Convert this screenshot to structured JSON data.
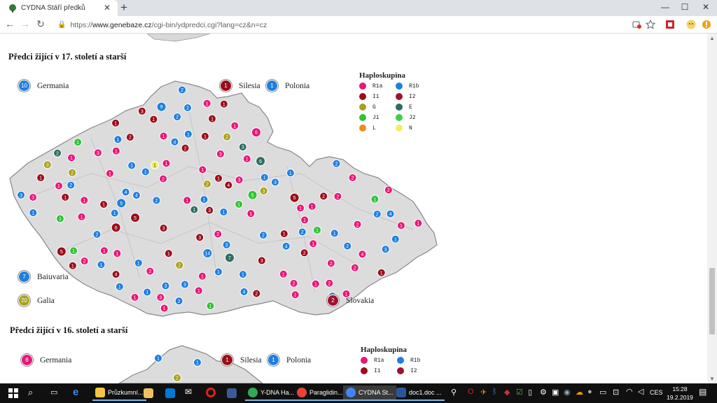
{
  "browser": {
    "tab_title": "CYDNA Stáří předků",
    "url_scheme": "https://",
    "url_host": "www.genebaze.cz",
    "url_path": "/cgi-bin/ydpredci.cgi?lang=cz&n=cz"
  },
  "section1": {
    "heading": "Předci žijící v 17. století a starší",
    "regions": [
      {
        "name": "Germania",
        "count": "10"
      },
      {
        "name": "Silesia",
        "count": "1"
      },
      {
        "name": "Polonia",
        "count": "1"
      },
      {
        "name": "Baiuvaria",
        "count": "7"
      },
      {
        "name": "Galia",
        "count": "20"
      },
      {
        "name": "Slovakia",
        "count": "2"
      }
    ],
    "legend_title": "Haploskupina",
    "legend": [
      {
        "label": "R1a",
        "color": "#e8177a"
      },
      {
        "label": "R1b",
        "color": "#1e7fe0"
      },
      {
        "label": "I1",
        "color": "#9b0d1a"
      },
      {
        "label": "I2",
        "color": "#a01030"
      },
      {
        "label": "G",
        "color": "#a8a21a"
      },
      {
        "label": "E",
        "color": "#2e6e62"
      },
      {
        "label": "J1",
        "color": "#2ec436"
      },
      {
        "label": "J2",
        "color": "#3cd048"
      },
      {
        "label": "L",
        "color": "#f08a20"
      },
      {
        "label": "N",
        "color": "#f2ee60"
      }
    ]
  },
  "section2": {
    "heading": "Předci žijící v 16. století a starší",
    "regions": [
      {
        "name": "Germania",
        "count": "8"
      },
      {
        "name": "Silesia",
        "count": "1"
      },
      {
        "name": "Polonia",
        "count": "1"
      }
    ],
    "legend_title": "Haploskupina",
    "legend": [
      {
        "label": "R1a",
        "color": "#e8177a"
      },
      {
        "label": "R1b",
        "color": "#1e7fe0"
      },
      {
        "label": "I1",
        "color": "#9b0d1a"
      },
      {
        "label": "I2",
        "color": "#a01030"
      }
    ]
  },
  "map_markers": [
    [
      "1",
      "#1e7fe0"
    ],
    [
      "1",
      "#1e7fe0"
    ],
    [
      "1",
      "#1e7fe0"
    ],
    [
      "1",
      "#1e7fe0"
    ],
    [
      "2",
      "#a8a21a"
    ],
    [
      "5",
      "#2ec436"
    ],
    [
      "2",
      "#1e7fe0"
    ],
    [
      "1",
      "#2e6e62"
    ],
    [
      "1",
      "#9b0d1a"
    ],
    [
      "1",
      "#e8177a"
    ],
    [
      "2",
      "#e8177a"
    ],
    [
      "1",
      "#e8177a"
    ],
    [
      "1",
      "#1e7fe0"
    ],
    [
      "1",
      "#1e7fe0"
    ],
    [
      "1",
      "#e8177a"
    ],
    [
      "1",
      "#9b0d1a"
    ],
    [
      "2",
      "#1e7fe0"
    ],
    [
      "1",
      "#e8177a"
    ],
    [
      "2",
      "#a8a21a"
    ],
    [
      "2",
      "#9b0d1a"
    ],
    [
      "1",
      "#f2ee60"
    ],
    [
      "1",
      "#e8177a"
    ],
    [
      "2",
      "#9b0d1a"
    ],
    [
      "3",
      "#a8a21a"
    ],
    [
      "1",
      "#9b0d1a"
    ],
    [
      "1",
      "#e8177a"
    ],
    [
      "2",
      "#e8177a"
    ],
    [
      "4",
      "#9b0d1a"
    ],
    [
      "1",
      "#1e7fe0"
    ],
    [
      "4",
      "#1e7fe0"
    ],
    [
      "3",
      "#a8a21a"
    ],
    [
      "1",
      "#e8177a"
    ],
    [
      "2",
      "#1e7fe0"
    ],
    [
      "1",
      "#9b0d1a"
    ],
    [
      "14",
      "#1e7fe0"
    ],
    [
      "3",
      "#e8177a"
    ],
    [
      "1",
      "#2ec436"
    ],
    [
      "1",
      "#1e7fe0"
    ],
    [
      "3",
      "#e8177a"
    ],
    [
      "1",
      "#e8177a"
    ],
    [
      "4",
      "#1e7fe0"
    ],
    [
      "3",
      "#e8177a"
    ],
    [
      "5",
      "#9b0d1a"
    ],
    [
      "1",
      "#1e7fe0"
    ],
    [
      "1",
      "#2ec436"
    ],
    [
      "3",
      "#1e7fe0"
    ],
    [
      "1",
      "#e8177a"
    ],
    [
      "1",
      "#e8177a"
    ],
    [
      "1",
      "#1e7fe0"
    ],
    [
      "2",
      "#e8177a"
    ],
    [
      "4",
      "#9b0d1a"
    ],
    [
      "3",
      "#1e7fe0"
    ],
    [
      "1",
      "#9b0d1a"
    ],
    [
      "2",
      "#1e7fe0"
    ],
    [
      "1",
      "#e8177a"
    ],
    [
      "1",
      "#1e7fe0"
    ],
    [
      "2",
      "#e8177a"
    ],
    [
      "4",
      "#1e7fe0"
    ],
    [
      "1",
      "#e8177a"
    ],
    [
      "3",
      "#9b0d1a"
    ],
    [
      "1",
      "#1e7fe0"
    ],
    [
      "2",
      "#1e7fe0"
    ],
    [
      "1",
      "#2ec436"
    ],
    [
      "3",
      "#2e6e62"
    ],
    [
      "1",
      "#e8177a"
    ],
    [
      "2",
      "#9b0d1a"
    ],
    [
      "6",
      "#9b0d1a"
    ],
    [
      "2",
      "#1e7fe0"
    ],
    [
      "2",
      "#e8177a"
    ],
    [
      "1",
      "#9b0d1a"
    ],
    [
      "1",
      "#e8177a"
    ],
    [
      "2",
      "#1e7fe0"
    ],
    [
      "5",
      "#9b0d1a"
    ],
    [
      "1",
      "#e8177a"
    ],
    [
      "1",
      "#e8177a"
    ],
    [
      "2",
      "#a8a21a"
    ],
    [
      "4",
      "#e8177a"
    ],
    [
      "1",
      "#2ec436"
    ],
    [
      "3",
      "#1e7fe0"
    ],
    [
      "1",
      "#e8177a"
    ],
    [
      "2",
      "#e8177a"
    ],
    [
      "1",
      "#9b0d1a"
    ],
    [
      "3",
      "#e8177a"
    ],
    [
      "5",
      "#1e7fe0"
    ],
    [
      "6",
      "#e8177a"
    ],
    [
      "2",
      "#1e7fe0"
    ],
    [
      "1",
      "#9b0d1a"
    ],
    [
      "3",
      "#1e7fe0"
    ],
    [
      "2",
      "#2e6e62"
    ],
    [
      "3",
      "#9b0d1a"
    ],
    [
      "2",
      "#9b0d1a"
    ],
    [
      "1",
      "#e8177a"
    ],
    [
      "2",
      "#e8177a"
    ],
    [
      "1",
      "#9b0d1a"
    ],
    [
      "3",
      "#1e7fe0"
    ],
    [
      "1",
      "#9b0d1a"
    ],
    [
      "1",
      "#e8177a"
    ],
    [
      "2",
      "#9b0d1a"
    ],
    [
      "3",
      "#e8177a"
    ],
    [
      "1",
      "#1e7fe0"
    ],
    [
      "2",
      "#a8a21a"
    ],
    [
      "3",
      "#9b0d1a"
    ],
    [
      "1",
      "#e8177a"
    ],
    [
      "2",
      "#e8177a"
    ],
    [
      "1",
      "#1e7fe0"
    ],
    [
      "4",
      "#1e7fe0"
    ],
    [
      "1",
      "#1e7fe0"
    ],
    [
      "7",
      "#2e6e62"
    ],
    [
      "3",
      "#9b0d1a"
    ],
    [
      "1",
      "#9b0d1a"
    ],
    [
      "1",
      "#e8177a"
    ],
    [
      "2",
      "#1e7fe0"
    ],
    [
      "9",
      "#1e7fe0"
    ],
    [
      "1",
      "#2ec436"
    ],
    [
      "2",
      "#1e7fe0"
    ],
    [
      "1",
      "#9b0d1a"
    ],
    [
      "1",
      "#1e7fe0"
    ],
    [
      "1",
      "#e8177a"
    ],
    [
      "3",
      "#1e7fe0"
    ],
    [
      "1",
      "#e8177a"
    ],
    [
      "2",
      "#e8177a"
    ],
    [
      "1",
      "#e8177a"
    ],
    [
      "2",
      "#1e7fe0"
    ],
    [
      "3",
      "#9b0d1a"
    ],
    [
      "5",
      "#9b0d1a"
    ],
    [
      "1",
      "#e8177a"
    ],
    [
      "6",
      "#2e6e62"
    ],
    [
      "2",
      "#1e7fe0"
    ],
    [
      "4",
      "#1e7fe0"
    ],
    [
      "1",
      "#2ec436"
    ],
    [
      "1",
      "#e8177a"
    ],
    [
      "2",
      "#e8177a"
    ],
    [
      "1",
      "#e8177a"
    ],
    [
      "1",
      "#1e7fe0"
    ],
    [
      "4",
      "#1e7fe0"
    ],
    [
      "2",
      "#e8177a"
    ],
    [
      "1",
      "#e8177a"
    ],
    [
      "1",
      "#2ec436"
    ],
    [
      "1",
      "#9b0d1a"
    ],
    [
      "1",
      "#1e7fe0"
    ],
    [
      "1",
      "#e8177a"
    ],
    [
      "3",
      "#1e7fe0"
    ],
    [
      "1",
      "#e8177a"
    ],
    [
      "2",
      "#e8177a"
    ]
  ],
  "taskbar": {
    "apps": [
      {
        "label": "Průzkumní...",
        "color": "#f4c542"
      },
      {
        "label": "Y-DNA Ha...",
        "color": "#34a853"
      },
      {
        "label": "Paraglidin...",
        "color": "#ea4335"
      },
      {
        "label": "CYDNA St...",
        "color": "#4285f4"
      },
      {
        "label": "doc1.doc ...",
        "color": "#2b579a"
      }
    ],
    "language": "CES",
    "time": "15:28",
    "date": "19.2.2019"
  }
}
